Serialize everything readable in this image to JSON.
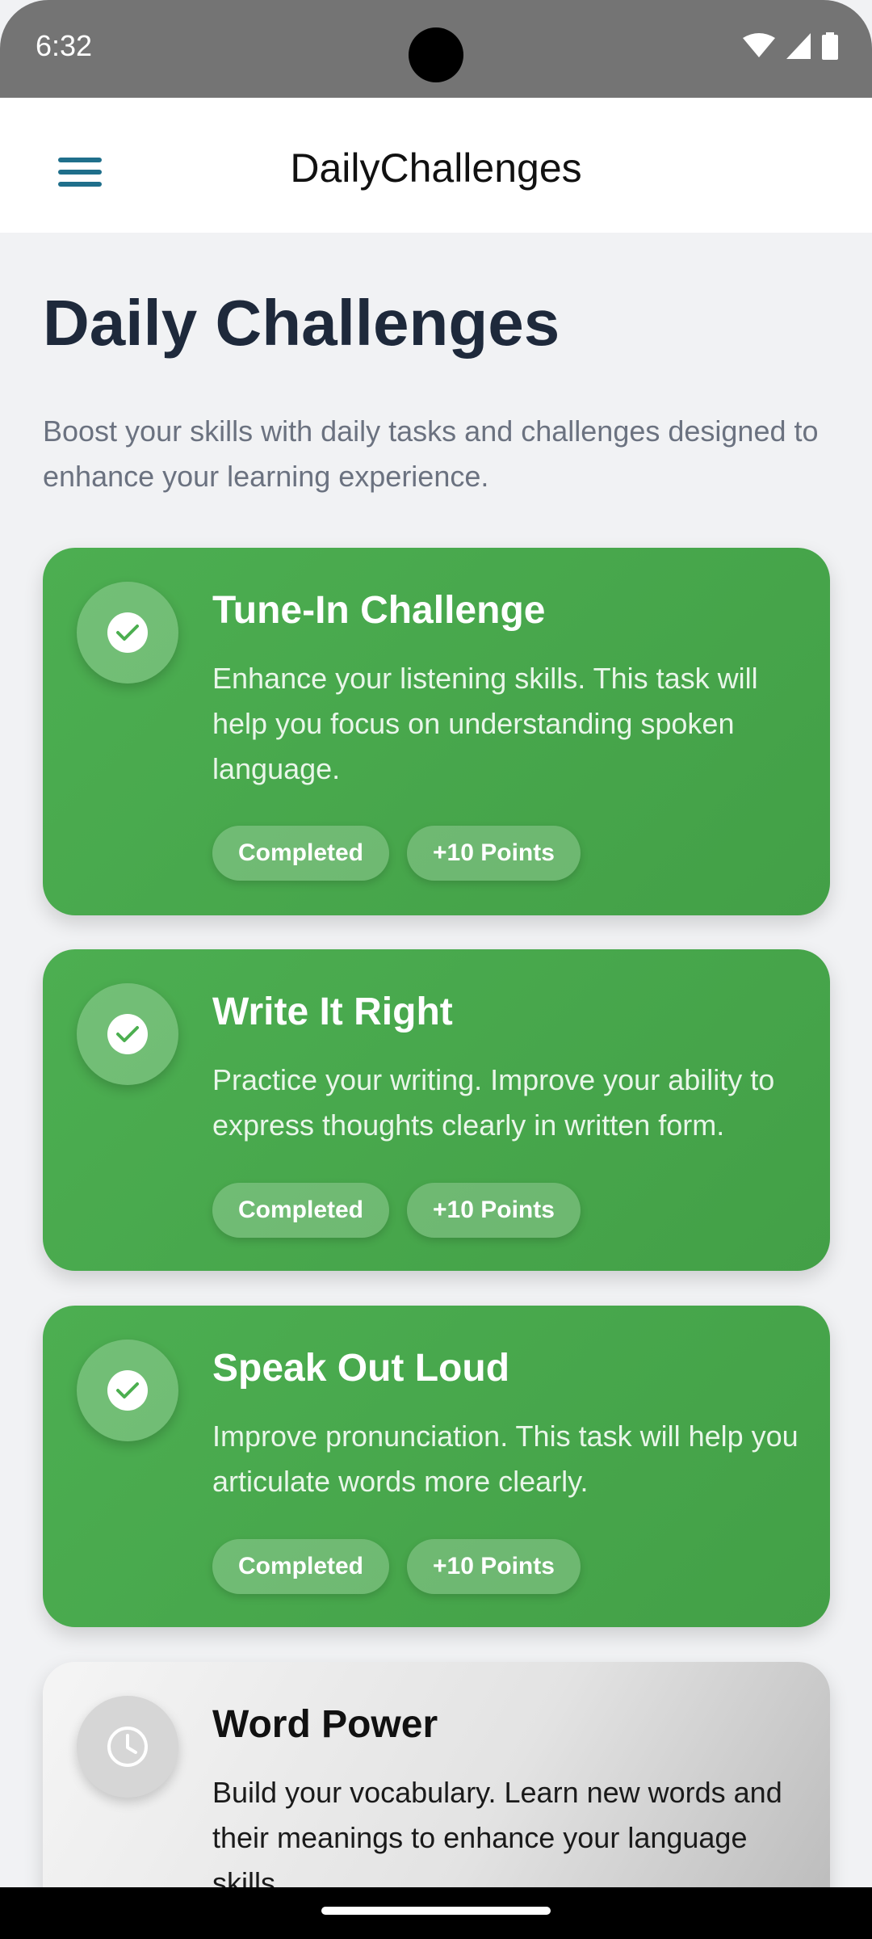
{
  "status_bar": {
    "time": "6:32"
  },
  "app_bar": {
    "title": "DailyChallenges"
  },
  "page": {
    "title": "Daily Challenges",
    "description": "Boost your skills with daily tasks and challenges designed to enhance your learning experience."
  },
  "challenges": [
    {
      "title": "Tune-In Challenge",
      "description": "Enhance your listening skills. This task will help you focus on understanding spoken language.",
      "status": "Completed",
      "points": "+10 Points",
      "icon": "check-icon"
    },
    {
      "title": "Write It Right",
      "description": "Practice your writing. Improve your ability to express thoughts clearly in written form.",
      "status": "Completed",
      "points": "+10 Points",
      "icon": "check-icon"
    },
    {
      "title": "Speak Out Loud",
      "description": "Improve pronunciation. This task will help you articulate words more clearly.",
      "status": "Completed",
      "points": "+10 Points",
      "icon": "check-icon"
    },
    {
      "title": "Word Power",
      "description": "Build your vocabulary. Learn new words and their meanings to enhance your language skills.",
      "icon": "clock-icon"
    }
  ],
  "colors": {
    "completed_card": "#4caf50",
    "title_text": "#1e293b",
    "menu_icon": "#1f6f8b"
  }
}
